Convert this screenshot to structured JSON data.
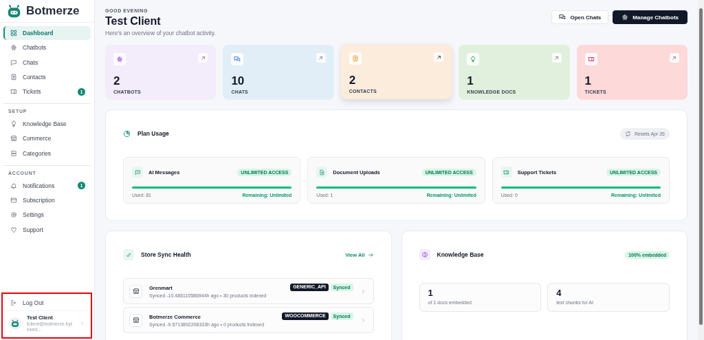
{
  "brand": {
    "name": "Botmerze"
  },
  "sidebar": {
    "sections": [
      {
        "items": [
          {
            "label": "Dashboard",
            "selected": true
          },
          {
            "label": "Chatbots",
            "selected": false
          },
          {
            "label": "Chats",
            "selected": false
          },
          {
            "label": "Contacts",
            "selected": false
          },
          {
            "label": "Tickets",
            "selected": false,
            "badge": "1"
          }
        ]
      },
      {
        "heading": "SETUP",
        "items": [
          {
            "label": "Knowledge Base",
            "selected": false
          },
          {
            "label": "Commerce",
            "selected": false
          },
          {
            "label": "Categories",
            "selected": false
          }
        ]
      },
      {
        "heading": "ACCOUNT",
        "items": [
          {
            "label": "Notifications",
            "selected": false,
            "badge": "1"
          },
          {
            "label": "Subscription",
            "selected": false
          },
          {
            "label": "Settings",
            "selected": false
          },
          {
            "label": "Support",
            "selected": false
          }
        ]
      }
    ],
    "footer": {
      "logout": "Log Out",
      "user_name": "Test Client",
      "user_email": "tclient@botmerze.bytesed..."
    }
  },
  "header": {
    "greeting": "GOOD EVENING",
    "title": "Test Client",
    "subtitle": "Here's an overview of your chatbot activity.",
    "buttons": [
      "Open Chats",
      "Manage Chatbots"
    ]
  },
  "stats": [
    {
      "value": "2",
      "label": "CHATBOTS",
      "color": "#f3ecfb",
      "hovered": false
    },
    {
      "value": "10",
      "label": "CHATS",
      "color": "#e2eef7",
      "hovered": false
    },
    {
      "value": "2",
      "label": "CONTACTS",
      "color": "#fcecdc",
      "hovered": true
    },
    {
      "value": "1",
      "label": "KNOWLEDGE DOCS",
      "color": "#e1f0dc",
      "hovered": false
    },
    {
      "value": "1",
      "label": "TICKETS",
      "color": "#fdd9d9",
      "hovered": false
    }
  ],
  "plan_usage": {
    "title": "Plan Usage",
    "resets": "Resets Apr 26",
    "items": [
      {
        "name": "AI Messages",
        "badge": "UNLIMITED ACCESS",
        "level": 1,
        "used": "Used: 81",
        "remaining": "Remaining: Unlimited"
      },
      {
        "name": "Document Uploads",
        "badge": "UNLIMITED ACCESS",
        "level": 1,
        "used": "Used: 1",
        "remaining": "Remaining: Unlimited"
      },
      {
        "name": "Support Tickets",
        "badge": "UNLIMITED ACCESS",
        "level": 1,
        "used": "Used: 0",
        "remaining": "Remaining: Unlimited"
      }
    ]
  },
  "store_sync": {
    "title": "Store Sync Health",
    "link": "View All",
    "stores": [
      {
        "name": "Grenmart",
        "detail": "Synced -10.486110586944h ago • 30 products indexed",
        "platform": "GENERIC_API",
        "status": "Synced"
      },
      {
        "name": "Botmerze Commerce",
        "detail": "Synced -9.5713892208333h ago • 0 products indexed",
        "platform": "WOOCOMMERCE",
        "status": "Synced"
      }
    ]
  },
  "knowledge_base": {
    "title": "Knowledge Base",
    "badge": "100% embedded",
    "stats": [
      {
        "value": "1",
        "label": "of 1 docs embedded"
      },
      {
        "value": "4",
        "label": "text chunks for AI"
      }
    ]
  }
}
